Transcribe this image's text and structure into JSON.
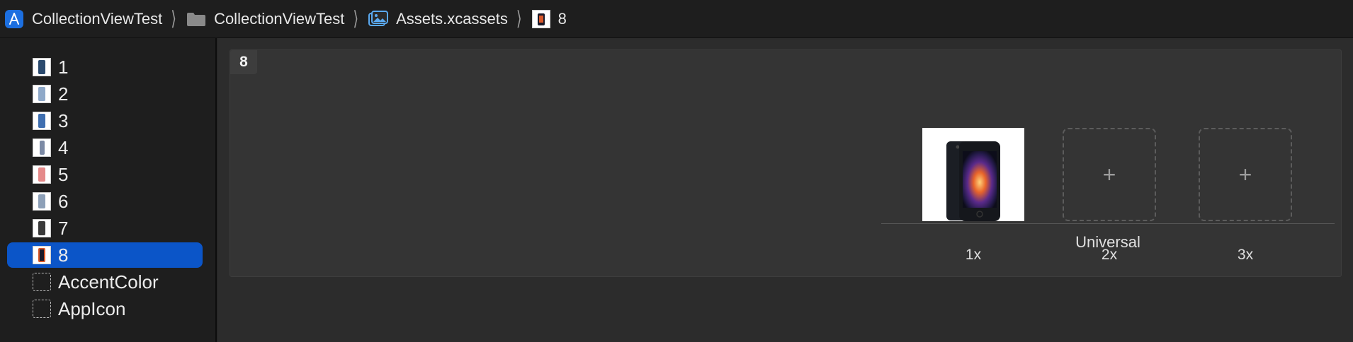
{
  "breadcrumb": {
    "items": [
      {
        "label": "CollectionViewTest",
        "icon": "app-project-icon"
      },
      {
        "label": "CollectionViewTest",
        "icon": "folder-icon"
      },
      {
        "label": "Assets.xcassets",
        "icon": "asset-catalog-icon"
      },
      {
        "label": "8",
        "icon": "image-set-icon"
      }
    ],
    "separator": "⟩"
  },
  "sidebar": {
    "items": [
      {
        "label": "1",
        "type": "image-set"
      },
      {
        "label": "2",
        "type": "image-set"
      },
      {
        "label": "3",
        "type": "image-set"
      },
      {
        "label": "4",
        "type": "image-set"
      },
      {
        "label": "5",
        "type": "image-set"
      },
      {
        "label": "6",
        "type": "image-set"
      },
      {
        "label": "7",
        "type": "image-set"
      },
      {
        "label": "8",
        "type": "image-set",
        "selected": true
      },
      {
        "label": "AccentColor",
        "type": "color-set"
      },
      {
        "label": "AppIcon",
        "type": "app-icon-set"
      }
    ]
  },
  "editor": {
    "set_name": "8",
    "slots": [
      {
        "scale": "1x",
        "filled": true
      },
      {
        "scale": "2x",
        "filled": false,
        "placeholder": "+"
      },
      {
        "scale": "3x",
        "filled": false,
        "placeholder": "+"
      }
    ],
    "device_group": "Universal"
  },
  "colors": {
    "selection": "#0b55c8",
    "sidebar_bg": "#1e1e1e",
    "editor_bg": "#2c2c2c"
  }
}
